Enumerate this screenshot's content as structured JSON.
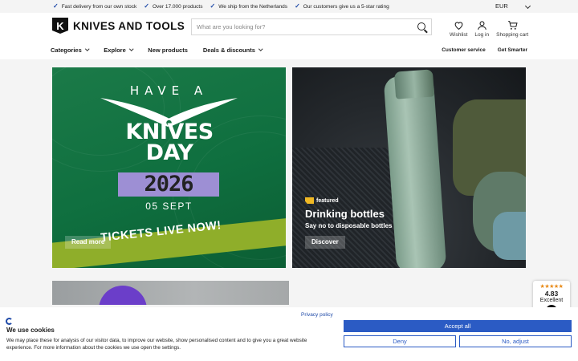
{
  "topbar": {
    "usps": [
      "Fast delivery from our own stock",
      "Over 17.000 products",
      "We ship from the Netherlands",
      "Our customers give us a 5-star rating"
    ],
    "currency": "EUR"
  },
  "header": {
    "logo_text": "KNIVES AND TOOLS",
    "logo_mark": "K",
    "search_placeholder": "What are you looking for?",
    "icons": [
      {
        "label": "Wishlist",
        "icon": "heart-icon"
      },
      {
        "label": "Log in",
        "icon": "user-icon"
      },
      {
        "label": "Shopping cart",
        "icon": "cart-icon"
      }
    ]
  },
  "nav": {
    "left": [
      {
        "label": "Categories",
        "dropdown": true
      },
      {
        "label": "Explore",
        "dropdown": true
      },
      {
        "label": "New products",
        "dropdown": false
      },
      {
        "label": "Deals & discounts",
        "dropdown": true
      }
    ],
    "right": [
      "Customer service",
      "Get Smarter"
    ]
  },
  "hero_left": {
    "line1": "HAVE A",
    "line2": "KNIVES",
    "line3": "DAY",
    "year": "2026",
    "date": "05 SEPT",
    "banner": "TICKETS LIVE NOW!",
    "button": "Read more",
    "colors": {
      "background": "#157342",
      "strip": "#8fae2a",
      "year_bg": "#9d8fd4"
    }
  },
  "hero_right": {
    "tag": "featured",
    "title": "Drinking bottles",
    "subtitle": "Say no to disposable bottles",
    "button": "Discover",
    "tag_color": "#f0b824"
  },
  "rating": {
    "stars": "★★★★★",
    "score": "4.83",
    "label": "Excellent"
  },
  "cookie": {
    "title": "We use cookies",
    "text": "We may place these for analysis of our visitor data, to improve our website, show personalised content and to give you a great website experience. For more information about the cookies we use open the settings.",
    "privacy": "Privacy policy",
    "accept": "Accept all",
    "deny": "Deny",
    "adjust": "No, adjust",
    "accent": "#2b5bc4"
  }
}
